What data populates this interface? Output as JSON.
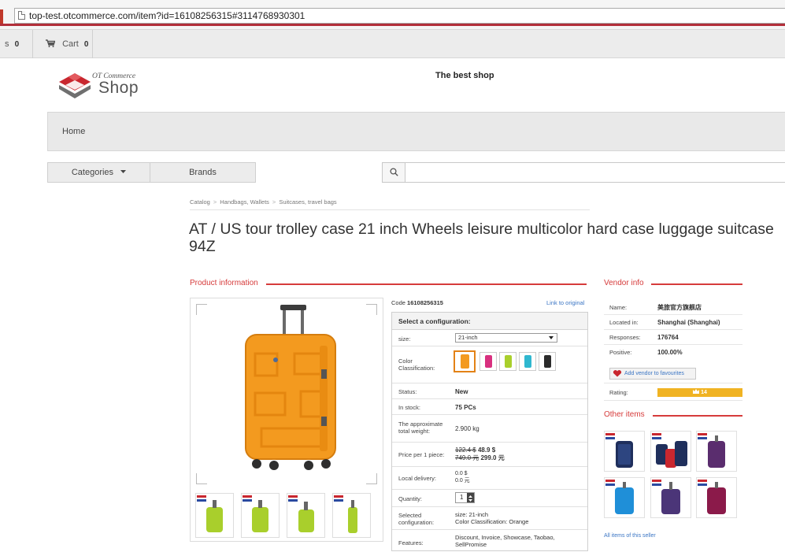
{
  "browser": {
    "url": "top-test.otcommerce.com/item?id=16108256315#3114768930301"
  },
  "topbar": {
    "prev_label": "s",
    "prev_count": "0",
    "cart_label": "Cart",
    "cart_count": "0"
  },
  "header": {
    "logo_line1": "OT Commerce",
    "logo_line2": "Shop",
    "tagline": "The best shop"
  },
  "nav": {
    "home": "Home",
    "categories": "Categories",
    "brands": "Brands",
    "search_placeholder": ""
  },
  "breadcrumb": [
    "Catalog",
    "Handbags, Wallets",
    "Suitcases, travel bags"
  ],
  "product": {
    "title": "AT / US tour trolley case 21 inch Wheels leisure multicolor hard case luggage suitcase 94Z",
    "section_label": "Product information",
    "code_label": "Code",
    "code": "16108256315",
    "link_original": "Link to original",
    "config_head": "Select a configuration:",
    "size_label": "size:",
    "size_value": "21-inch",
    "color_label": "Color Classification:",
    "colors": [
      "#f39a1f",
      "#d8307f",
      "#a9cf2c",
      "#2fb7cf",
      "#2b2b2b"
    ],
    "status_label": "Status:",
    "status_value": "New",
    "stock_label": "In stock:",
    "stock_value": "75 PCs",
    "weight_label": "The approximate total weight:",
    "weight_value": "2.900 kg",
    "price_label": "Price per 1 piece:",
    "price_old_usd": "122.4 $",
    "price_new_usd": "48.9 $",
    "price_old_cny": "749.0 元",
    "price_new_cny": "299.0 元",
    "delivery_label": "Local delivery:",
    "delivery_usd": "0.0 $",
    "delivery_cny": "0.0 元",
    "quantity_label": "Quantity:",
    "quantity_value": "1",
    "selected_label": "Selected configuration:",
    "selected_line1": "size: 21-inch",
    "selected_line2": "Color Classification: Orange",
    "features_label": "Features:",
    "features_value": "Discount, Invoice, Showcase, Taobao, SellPromise"
  },
  "vendor": {
    "section_label": "Vendor info",
    "name_label": "Name:",
    "name_value": "美旅官方旗舰店",
    "located_label": "Located in:",
    "located_value": "Shanghai (Shanghai)",
    "responses_label": "Responses:",
    "responses_value": "176764",
    "positive_label": "Positive:",
    "positive_value": "100.00%",
    "fav_button": "Add vendor to favourites",
    "rating_label": "Rating:",
    "rating_value": "14",
    "other_items_label": "Other items",
    "all_items_link": "All items of this seller"
  },
  "colors": {
    "accent_red": "#d63b3b",
    "link_blue": "#3a75c4",
    "rating_gold": "#f0b323",
    "suitcase_orange": "#f39a1f",
    "thumb_green": "#a9cf2c"
  }
}
